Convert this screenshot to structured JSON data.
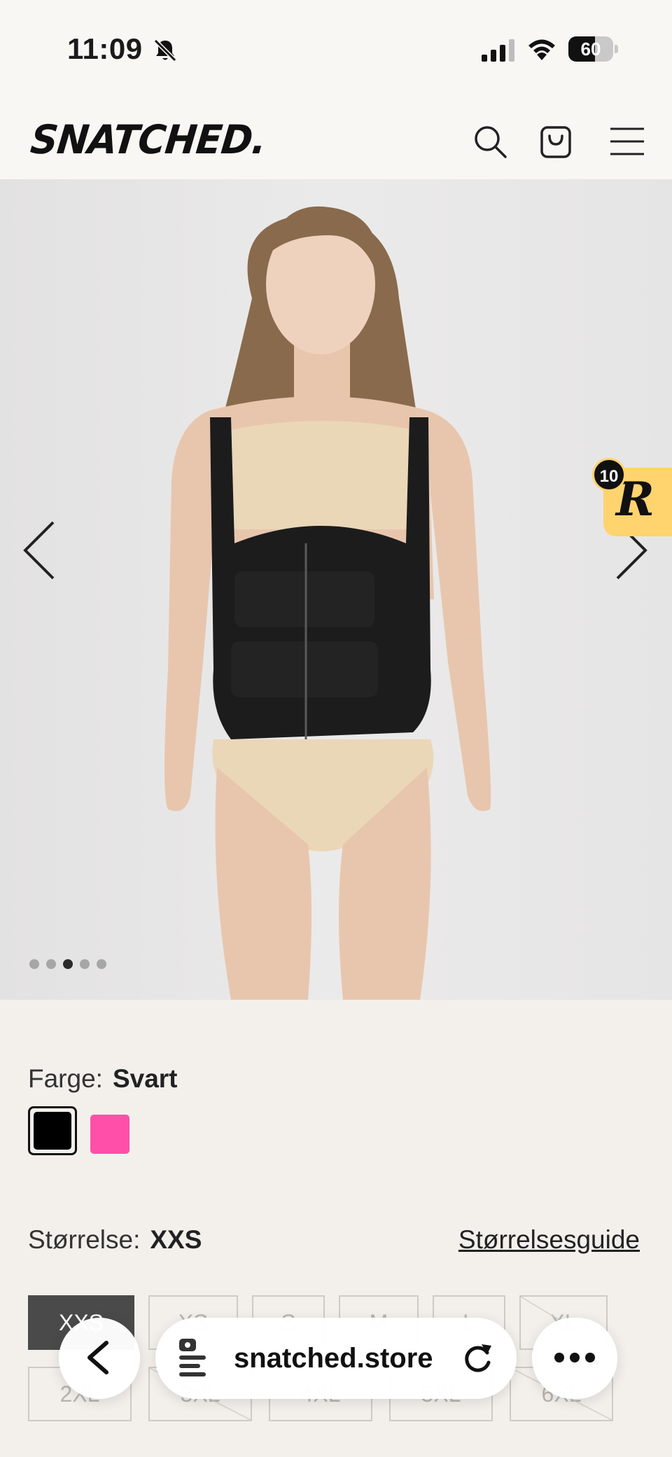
{
  "status_bar": {
    "time": "11:09",
    "battery_level": "60",
    "battery_fraction": 0.6
  },
  "header": {
    "logo": "SNATCHED.",
    "icons": [
      "search-icon",
      "cart-icon",
      "menu-icon"
    ]
  },
  "gallery": {
    "image_count": 5,
    "active_index": 2
  },
  "rewards": {
    "letter": "R",
    "count": "10",
    "color": "#ffd36e"
  },
  "product": {
    "color_label": "Farge:",
    "color_value": "Svart",
    "swatches": [
      {
        "name": "Svart",
        "hex": "#000000",
        "selected": true
      },
      {
        "name": "Rosa",
        "hex": "#ff4fa8",
        "selected": false
      }
    ],
    "size_label": "Størrelse:",
    "size_value": "XXS",
    "size_guide": "Størrelsesguide",
    "sizes_row1": [
      {
        "label": "XXS",
        "selected": true,
        "disabled": false
      },
      {
        "label": "XS",
        "selected": false,
        "disabled": false
      },
      {
        "label": "S",
        "selected": false,
        "disabled": false
      },
      {
        "label": "M",
        "selected": false,
        "disabled": false
      },
      {
        "label": "L",
        "selected": false,
        "disabled": false
      },
      {
        "label": "XL",
        "selected": false,
        "disabled": true
      }
    ],
    "sizes_row2": [
      {
        "label": "2XL",
        "selected": false,
        "disabled": false
      },
      {
        "label": "3XL",
        "selected": false,
        "disabled": true
      },
      {
        "label": "4XL",
        "selected": false,
        "disabled": false
      },
      {
        "label": "5XL",
        "selected": false,
        "disabled": false
      },
      {
        "label": "6XL",
        "selected": false,
        "disabled": true
      }
    ]
  },
  "browser": {
    "url": "snatched.store"
  }
}
